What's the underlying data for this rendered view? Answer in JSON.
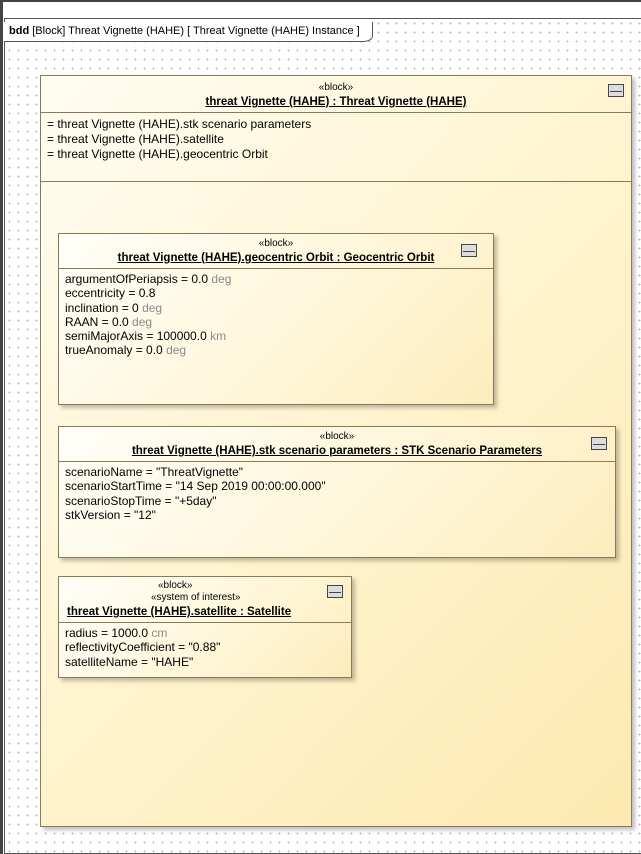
{
  "diagram_header": {
    "kind": "bdd",
    "text": "[Block] Threat Vignette (HAHE) [ Threat Vignette (HAHE) Instance ]"
  },
  "outer": {
    "stereotype": "«block»",
    "title": "threat Vignette (HAHE) : Threat Vignette (HAHE)",
    "parts": [
      "= threat Vignette (HAHE).stk scenario parameters",
      "= threat Vignette (HAHE).satellite",
      "= threat Vignette (HAHE).geocentric Orbit"
    ]
  },
  "orbit": {
    "stereotype": "«block»",
    "title": "threat Vignette (HAHE).geocentric Orbit : Geocentric Orbit",
    "attrs": [
      {
        "text": "argumentOfPeriapsis = 0.0",
        "unit": "deg"
      },
      {
        "text": "eccentricity = 0.8",
        "unit": ""
      },
      {
        "text": "inclination = 0",
        "unit": "deg"
      },
      {
        "text": "RAAN = 0.0",
        "unit": "deg"
      },
      {
        "text": "semiMajorAxis = 100000.0",
        "unit": "km"
      },
      {
        "text": "trueAnomaly = 0.0",
        "unit": "deg"
      }
    ]
  },
  "stk": {
    "stereotype": "«block»",
    "title": "threat Vignette (HAHE).stk scenario parameters : STK Scenario Parameters",
    "attrs": [
      {
        "text": "scenarioName = \"ThreatVignette\"",
        "unit": ""
      },
      {
        "text": "scenarioStartTime = \"14 Sep 2019 00:00:00.000\"",
        "unit": ""
      },
      {
        "text": "scenarioStopTime = \"+5day\"",
        "unit": ""
      },
      {
        "text": "stkVersion = \"12\"",
        "unit": ""
      }
    ]
  },
  "satellite": {
    "stereotype": "«block»",
    "stereotype2": "«system of interest»",
    "title": "threat Vignette (HAHE).satellite : Satellite",
    "attrs": [
      {
        "text": "radius = 1000.0",
        "unit": "cm"
      },
      {
        "text": "reflectivityCoefficient = \"0.88\"",
        "unit": ""
      },
      {
        "text": "satelliteName = \"HAHE\"",
        "unit": ""
      }
    ]
  }
}
